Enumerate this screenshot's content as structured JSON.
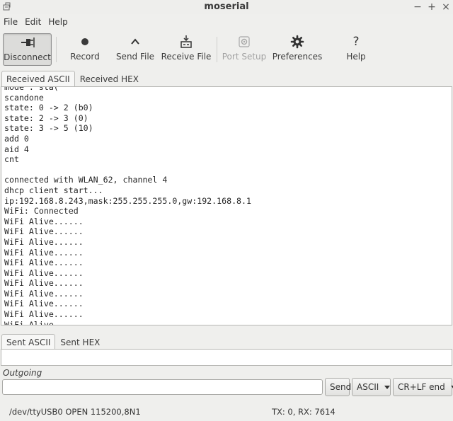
{
  "window": {
    "title": "moserial",
    "controls": [
      "−",
      "+",
      "×"
    ]
  },
  "menu": [
    {
      "id": "file",
      "label": "File"
    },
    {
      "id": "edit",
      "label": "Edit"
    },
    {
      "id": "help",
      "label": "Help"
    }
  ],
  "toolbar": [
    {
      "id": "disconnect",
      "label": "Disconnect",
      "icon": "plug-icon",
      "state": "pressed"
    },
    {
      "id": "record",
      "label": "Record",
      "icon": "record-dot-icon",
      "state": "normal"
    },
    {
      "id": "send-file",
      "label": "Send File",
      "icon": "upload-caret-icon",
      "state": "normal"
    },
    {
      "id": "receive-file",
      "label": "Receive File",
      "icon": "download-tray-icon",
      "state": "normal"
    },
    {
      "id": "port-setup",
      "label": "Port Setup",
      "icon": "gear-small-icon",
      "state": "disabled"
    },
    {
      "id": "preferences",
      "label": "Preferences",
      "icon": "gear-icon",
      "state": "normal"
    },
    {
      "id": "help",
      "label": "Help",
      "icon": "question-icon",
      "state": "normal"
    }
  ],
  "received_tabs": [
    {
      "label": "Received ASCII",
      "selected": true
    },
    {
      "label": "Received HEX",
      "selected": false
    }
  ],
  "received_lines": [
    "mode : sta(",
    "scandone",
    "state: 0 -> 2 (b0)",
    "state: 2 -> 3 (0)",
    "state: 3 -> 5 (10)",
    "add 0",
    "aid 4",
    "cnt",
    "",
    "connected with WLAN_62, channel 4",
    "dhcp client start...",
    "ip:192.168.8.243,mask:255.255.255.0,gw:192.168.8.1",
    "WiFi: Connected",
    "WiFi Alive......",
    "WiFi Alive......",
    "WiFi Alive......",
    "WiFi Alive......",
    "WiFi Alive......",
    "WiFi Alive......",
    "WiFi Alive......",
    "WiFi Alive......",
    "WiFi Alive......",
    "WiFi Alive......",
    "WiFi Alive......"
  ],
  "sent_tabs": [
    {
      "label": "Sent ASCII",
      "selected": true
    },
    {
      "label": "Sent HEX",
      "selected": false
    }
  ],
  "outgoing": {
    "label": "Outgoing",
    "value": "",
    "send_label": "Send",
    "mode_value": "ASCII",
    "line_end_value": "CR+LF end"
  },
  "status": {
    "port": "/dev/ttyUSB0 OPEN 115200,8N1",
    "counters": "TX: 0, RX: 7614"
  }
}
